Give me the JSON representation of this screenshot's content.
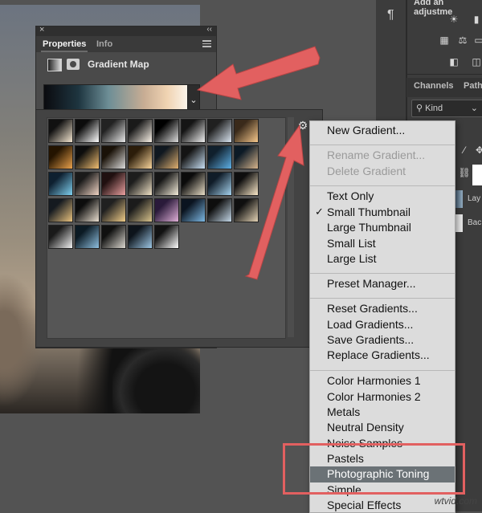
{
  "dock": {
    "adjustments_title": "Add an adjustme",
    "channels_tab": "Channels",
    "paths_tab": "Path",
    "kind_filter": "Kind",
    "layer1": "Lay",
    "layer2": "Bac"
  },
  "properties": {
    "tabs": [
      "Properties",
      "Info"
    ],
    "title": "Gradient Map"
  },
  "menu": {
    "items": [
      {
        "label": "New Gradient...",
        "disabled": false
      },
      {
        "label": "Rename Gradient...",
        "disabled": true
      },
      {
        "label": "Delete Gradient",
        "disabled": true
      },
      {
        "label": "Text Only",
        "disabled": false
      },
      {
        "label": "Small Thumbnail",
        "disabled": false,
        "checked": true
      },
      {
        "label": "Large Thumbnail",
        "disabled": false
      },
      {
        "label": "Small List",
        "disabled": false
      },
      {
        "label": "Large List",
        "disabled": false
      },
      {
        "label": "Preset Manager...",
        "disabled": false
      },
      {
        "label": "Reset Gradients...",
        "disabled": false
      },
      {
        "label": "Load Gradients...",
        "disabled": false
      },
      {
        "label": "Save Gradients...",
        "disabled": false
      },
      {
        "label": "Replace Gradients...",
        "disabled": false
      },
      {
        "label": "Color Harmonies 1",
        "disabled": false
      },
      {
        "label": "Color Harmonies 2",
        "disabled": false
      },
      {
        "label": "Metals",
        "disabled": false
      },
      {
        "label": "Neutral Density",
        "disabled": false
      },
      {
        "label": "Noise Samples",
        "disabled": false
      },
      {
        "label": "Pastels",
        "disabled": false
      },
      {
        "label": "Photographic Toning",
        "disabled": false,
        "highlighted": true
      },
      {
        "label": "Simple",
        "disabled": false
      },
      {
        "label": "Special Effects",
        "disabled": false
      }
    ]
  },
  "watermark": "wtvid.com",
  "colors": {
    "annotation": "#e26060",
    "menu_highlight": "#6b7276"
  }
}
